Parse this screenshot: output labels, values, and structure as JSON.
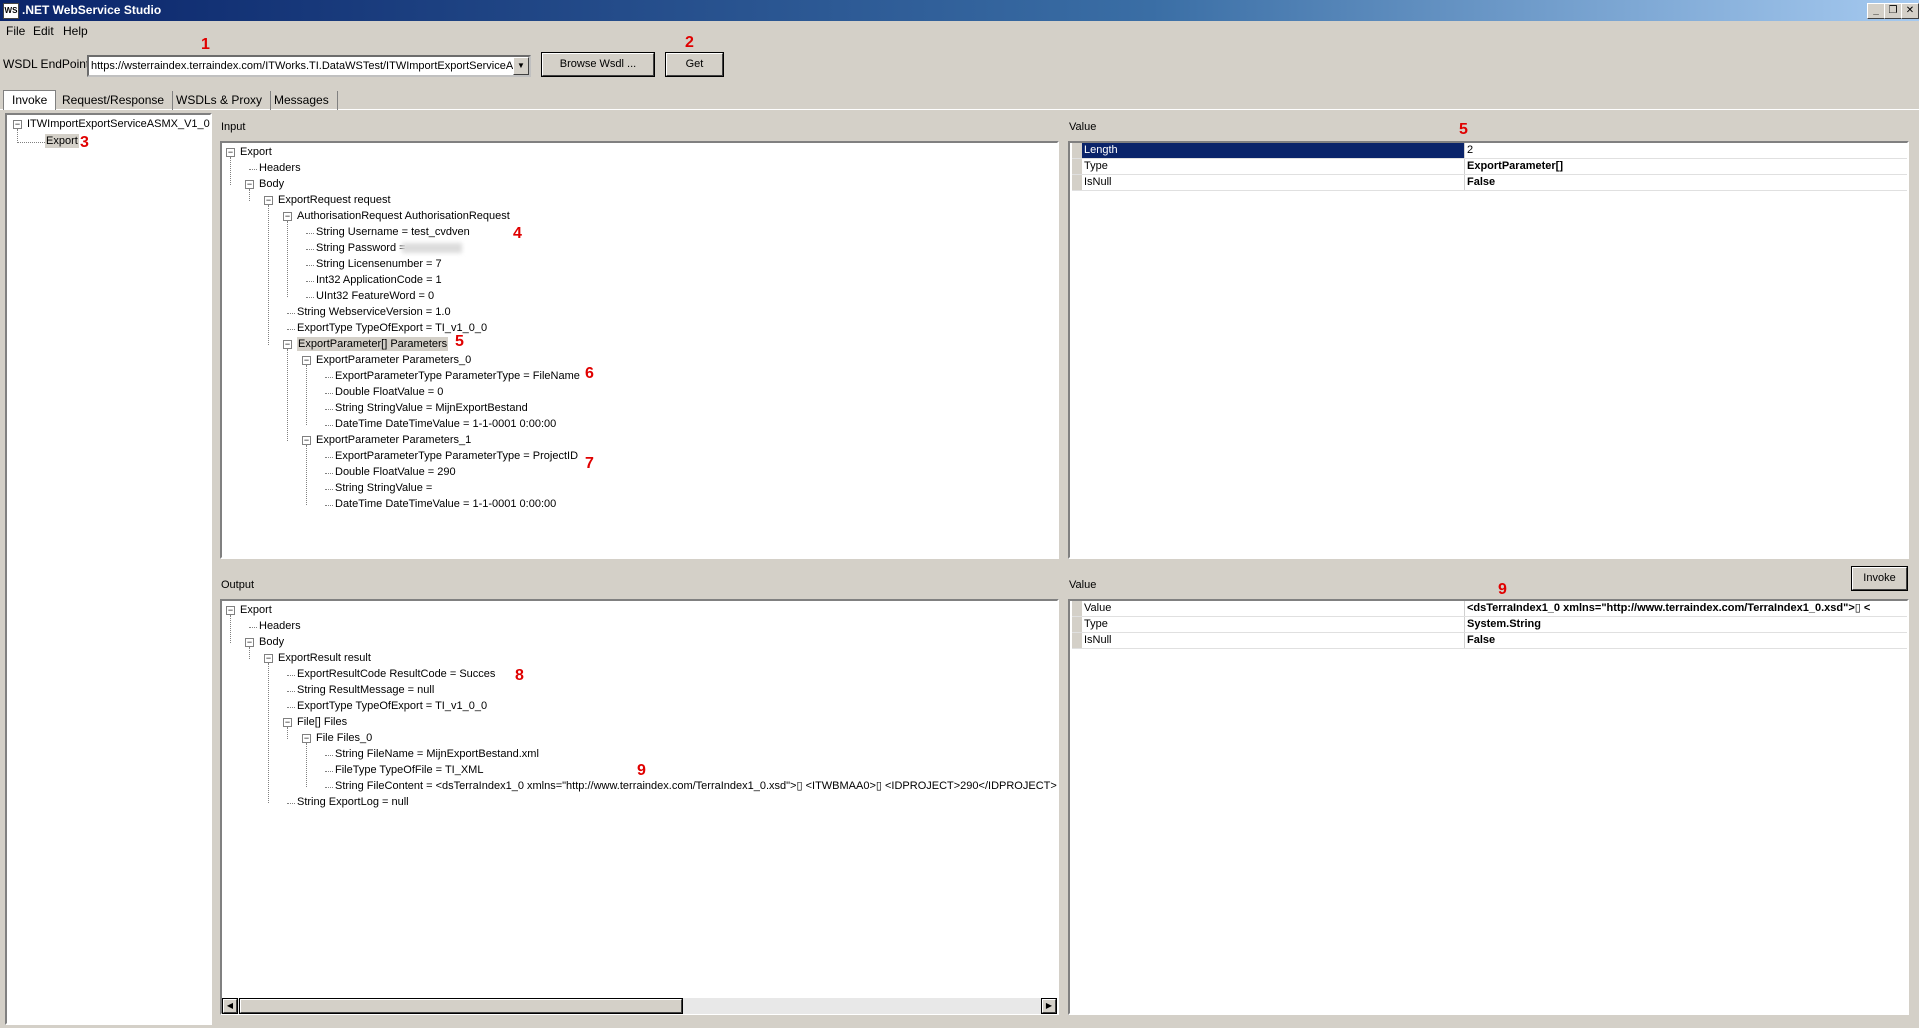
{
  "window": {
    "title": ".NET WebService Studio",
    "icon_text": "WS"
  },
  "window_buttons": [
    "_",
    "❐",
    "✕"
  ],
  "menu": [
    "File",
    "Edit",
    "Help"
  ],
  "endpoint": {
    "label": "WSDL EndPoint",
    "url": "https://wsterraindex.terraindex.com/ITWorks.TI.DataWSTest/ITWImportExportServiceA",
    "browse_button": "Browse Wsdl ...",
    "get_button": "Get"
  },
  "tabs": [
    "Invoke",
    "Request/Response",
    "WSDLs & Proxy",
    "Messages"
  ],
  "service_tree": {
    "root": "ITWImportExportServiceASMX_V1_0",
    "child": "Export"
  },
  "input_label": "Input",
  "output_label": "Output",
  "value_label_top": "Value",
  "value_label_bottom": "Value",
  "invoke_button": "Invoke",
  "input_tree": [
    "Export",
    "Headers",
    "Body",
    "ExportRequest request",
    "AuthorisationRequest AuthorisationRequest",
    "String Username = test_cvdven",
    "String Password = ",
    "String Licensenumber = 7",
    "Int32 ApplicationCode = 1",
    "UInt32 FeatureWord = 0",
    "String WebserviceVersion = 1.0",
    "ExportType TypeOfExport = TI_v1_0_0",
    "ExportParameter[] Parameters",
    "ExportParameter Parameters_0",
    "ExportParameterType ParameterType = FileName",
    "Double FloatValue = 0",
    "String StringValue = MijnExportBestand",
    "DateTime DateTimeValue = 1-1-0001 0:00:00",
    "ExportParameter Parameters_1",
    "ExportParameterType ParameterType = ProjectID",
    "Double FloatValue = 290",
    "String StringValue =",
    "DateTime DateTimeValue = 1-1-0001 0:00:00"
  ],
  "output_tree": [
    "Export",
    "Headers",
    "Body",
    "ExportResult result",
    "ExportResultCode ResultCode = Succes",
    "String ResultMessage = null",
    "ExportType TypeOfExport = TI_v1_0_0",
    "File[] Files",
    "File Files_0",
    "String FileName = MijnExportBestand.xml",
    "FileType TypeOfFile = TI_XML",
    "String FileContent = <dsTerraIndex1_0 xmlns=\"http://www.terraindex.com/TerraIndex1_0.xsd\">▯  <ITWBMAA0>▯    <IDPROJECT>290</IDPROJECT>▯",
    "String ExportLog = null"
  ],
  "input_props": [
    {
      "key": "Length",
      "value": "2"
    },
    {
      "key": "Type",
      "value": "ExportParameter[]"
    },
    {
      "key": "IsNull",
      "value": "False"
    }
  ],
  "output_props": [
    {
      "key": "Value",
      "value": "<dsTerraIndex1_0 xmlns=\"http://www.terraindex.com/TerraIndex1_0.xsd\">▯  <"
    },
    {
      "key": "Type",
      "value": "System.String"
    },
    {
      "key": "IsNull",
      "value": "False"
    }
  ],
  "annotations": [
    "1",
    "2",
    "3",
    "4",
    "5",
    "5",
    "6",
    "7",
    "8",
    "9",
    "9"
  ],
  "colors": {
    "title_start": "#0a246a",
    "selection": "#0a246a",
    "annotation": "#e00000",
    "face": "#d4d0c8"
  }
}
